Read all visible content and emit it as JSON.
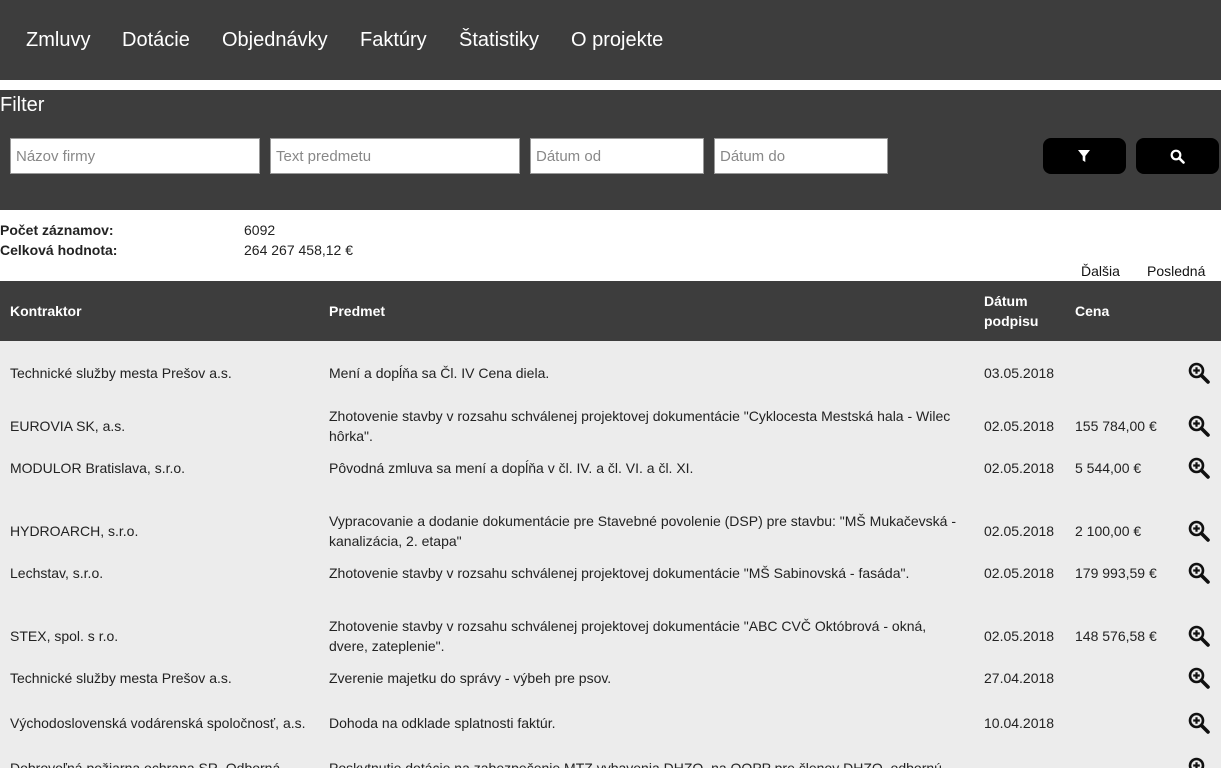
{
  "nav": [
    "Zmluvy",
    "Dotácie",
    "Objednávky",
    "Faktúry",
    "Štatistiky",
    "O projekte"
  ],
  "filter": {
    "title": "Filter",
    "firm_placeholder": "Názov firmy",
    "subject_placeholder": "Text predmetu",
    "date_from_placeholder": "Dátum od",
    "date_to_placeholder": "Dátum do"
  },
  "stats": {
    "count_label": "Počet záznamov:",
    "count_value": "6092",
    "total_label": "Celková hodnota:",
    "total_value": "264 267 458,12 €"
  },
  "pager": {
    "next": "Ďalšia",
    "last": "Posledná"
  },
  "table": {
    "headers": {
      "contractor": "Kontraktor",
      "subject": "Predmet",
      "date": "Dátum podpisu",
      "price": "Cena"
    },
    "rows": [
      {
        "contractor": "Technické služby mesta Prešov a.s.",
        "subject": "Mení a dopĺňa sa Čl. IV Cena diela.",
        "date": "03.05.2018",
        "price": ""
      },
      {
        "contractor": "EUROVIA SK, a.s.",
        "subject": "Zhotovenie stavby v rozsahu schválenej projektovej dokumentácie \"Cyklocesta Mestská hala - Wilec hôrka\".",
        "date": "02.05.2018",
        "price": "155 784,00 €"
      },
      {
        "contractor": "MODULOR Bratislava, s.r.o.",
        "subject": "Pôvodná zmluva sa mení a dopĺňa v čl. IV. a čl. VI. a čl. XI.",
        "date": "02.05.2018",
        "price": "5 544,00 €"
      },
      {
        "contractor": "HYDROARCH, s.r.o.",
        "subject": "Vypracovanie a dodanie dokumentácie pre Stavebné povolenie (DSP) pre stavbu: \"MŠ Mukačevská - kanalizácia, 2. etapa\"",
        "date": "02.05.2018",
        "price": "2 100,00 €"
      },
      {
        "contractor": "Lechstav, s.r.o.",
        "subject": "Zhotovenie stavby v rozsahu schválenej projektovej dokumentácie \"MŠ Sabinovská - fasáda\".",
        "date": "02.05.2018",
        "price": "179 993,59 €"
      },
      {
        "contractor": "STEX, spol. s r.o.",
        "subject": "Zhotovenie stavby v rozsahu schválenej projektovej dokumentácie \"ABC CVČ Októbrová - okná, dvere, zateplenie\".",
        "date": "02.05.2018",
        "price": "148 576,58 €"
      },
      {
        "contractor": "Technické služby mesta Prešov a.s.",
        "subject": "Zverenie majetku do správy - výbeh pre psov.",
        "date": "27.04.2018",
        "price": ""
      },
      {
        "contractor": "Východoslovenská vodárenská spoločnosť, a.s.",
        "subject": "Dohoda na odklade splatnosti faktúr.",
        "date": "10.04.2018",
        "price": ""
      },
      {
        "contractor": "Dobrovoľná požiarna ochrana SR, Odborná",
        "subject": "Poskytnutie dotácie na zabezpečenie MTZ vybavenia DHZO, na OOPP pre členov DHZO, odbornú",
        "date": "",
        "price": ""
      }
    ]
  }
}
